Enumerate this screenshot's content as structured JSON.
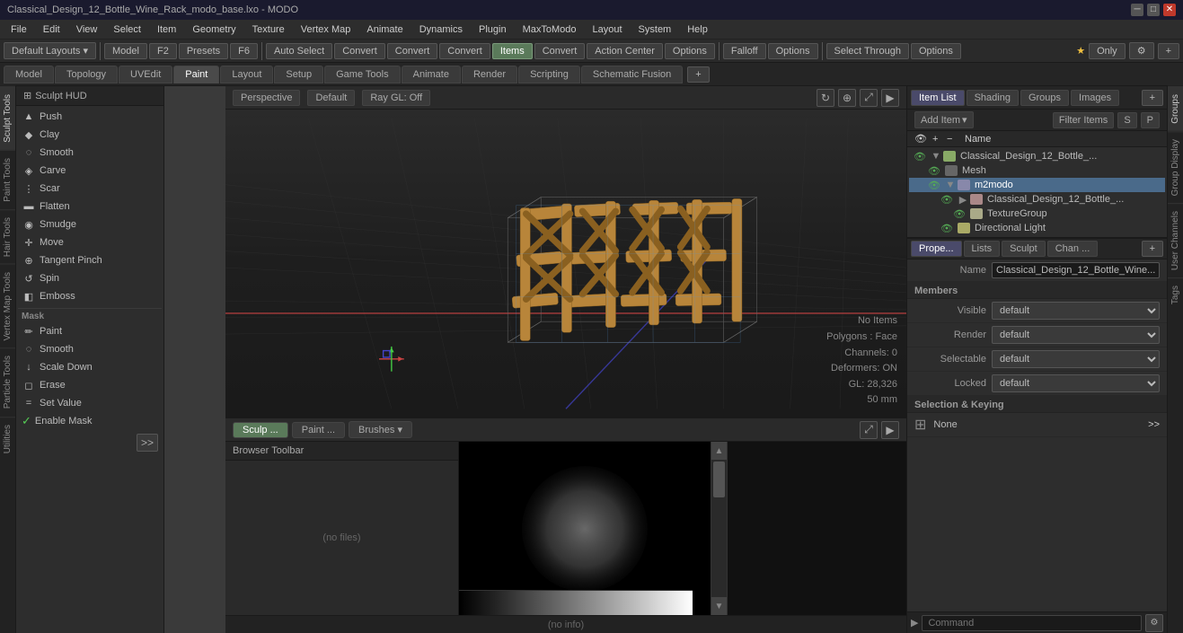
{
  "titlebar": {
    "title": "Classical_Design_12_Bottle_Wine_Rack_modo_base.lxo - MODO",
    "min": "─",
    "max": "□",
    "close": "✕"
  },
  "menubar": {
    "items": [
      "File",
      "Edit",
      "View",
      "Select",
      "Item",
      "Geometry",
      "Texture",
      "Vertex Map",
      "Animate",
      "Dynamics",
      "Texture",
      "Plugin",
      "MaxToModo",
      "Layout",
      "System",
      "Help"
    ]
  },
  "toolbar1": {
    "default_layouts": "Default Layouts ▾",
    "model": "Model",
    "f2": "F2",
    "presets": "Presets",
    "f6": "F6",
    "auto_select": "Auto Select",
    "convert1": "Convert",
    "convert2": "Convert",
    "convert3": "Convert",
    "convert4": "Convert",
    "items": "Items",
    "action_center": "Action Center",
    "options1": "Options",
    "falloff": "Falloff",
    "options2": "Options",
    "select_through": "Select Through",
    "options3": "Options"
  },
  "tabs": {
    "items": [
      "Model",
      "Topology",
      "UVEdit",
      "Paint",
      "Layout",
      "Setup",
      "Game Tools",
      "Animate",
      "Render",
      "Scripting",
      "Schematic Fusion"
    ]
  },
  "sculpt_tools": {
    "header": "Sculpt HUD",
    "tools": [
      {
        "name": "Push",
        "icon": "▲"
      },
      {
        "name": "Clay",
        "icon": "◆"
      },
      {
        "name": "Smooth",
        "icon": "◌"
      },
      {
        "name": "Carve",
        "icon": "◈"
      },
      {
        "name": "Scar",
        "icon": "⋮"
      },
      {
        "name": "Flatten",
        "icon": "▬"
      },
      {
        "name": "Smudge",
        "icon": "◉"
      },
      {
        "name": "Move",
        "icon": "✛"
      },
      {
        "name": "Tangent Pinch",
        "icon": "⊕"
      },
      {
        "name": "Spin",
        "icon": "↺"
      },
      {
        "name": "Emboss",
        "icon": "◧"
      }
    ],
    "mask_section": "Mask",
    "mask_tools": [
      {
        "name": "Paint",
        "icon": "✏"
      },
      {
        "name": "Smooth",
        "icon": "◌"
      },
      {
        "name": "Scale Down",
        "icon": "↓"
      }
    ],
    "other_tools": [
      {
        "name": "Erase",
        "icon": "◻"
      },
      {
        "name": "Set Value",
        "icon": "="
      },
      {
        "name": "Enable Mask",
        "icon": "✓",
        "checked": true
      }
    ]
  },
  "tool_tabs": [
    "Sculpt Tools",
    "Paint Tools",
    "Hair Tools",
    "Vertex Map Tools",
    "Particle Tools",
    "Utilities"
  ],
  "viewport": {
    "mode": "Perspective",
    "shading": "Default",
    "render": "Ray GL: Off",
    "info": {
      "no_items": "No Items",
      "polygons": "Polygons : Face",
      "channels": "Channels: 0",
      "deformers": "Deformers: ON",
      "gl": "GL: 28,326",
      "distance": "50 mm"
    }
  },
  "viewport_bottom": {
    "tabs": [
      "Sculp ...",
      "Paint ...",
      "Brushes ..."
    ],
    "browser_toolbar": "Browser Toolbar",
    "no_files": "(no files)"
  },
  "right_panel": {
    "tabs": [
      "Item List",
      "Shading",
      "Groups",
      "Images"
    ],
    "add_item": "Add Item",
    "filter": "Filter Items",
    "s_btn": "S",
    "p_btn": "P",
    "name_col": "Name",
    "tree": {
      "items": [
        {
          "name": "Classical_Design_12_Bottle_...",
          "level": 0,
          "type": "root",
          "icon": "folder"
        },
        {
          "name": "Mesh",
          "level": 1,
          "type": "mesh",
          "icon": "mesh"
        },
        {
          "name": "m2modo",
          "level": 1,
          "type": "group",
          "icon": "group"
        },
        {
          "name": "Classical_Design_12_Bottle_...",
          "level": 2,
          "type": "item",
          "icon": "item"
        },
        {
          "name": "TextureGroup",
          "level": 3,
          "type": "texture",
          "icon": "texture"
        },
        {
          "name": "Directional Light",
          "level": 2,
          "type": "light",
          "icon": "light"
        }
      ]
    }
  },
  "properties": {
    "tabs": [
      "Prope...",
      "Lists",
      "Sculpt",
      "Chan ..."
    ],
    "name_label": "Name",
    "name_value": "Classical_Design_12_Bottle_Wine...",
    "members_title": "Members",
    "visible_label": "Visible",
    "render_label": "Render",
    "selectable_label": "Selectable",
    "locked_label": "Locked",
    "visible_value": "default",
    "render_value": "default",
    "selectable_value": "default",
    "locked_value": "default",
    "selection_keying": "Selection & Keying",
    "none_label": "None"
  },
  "right_vtabs": [
    "Groups",
    "Group Display",
    "User Channels",
    "Tags"
  ],
  "command_bar": {
    "placeholder": "Command",
    "icon": "⚙"
  },
  "no_info": "(no info)"
}
